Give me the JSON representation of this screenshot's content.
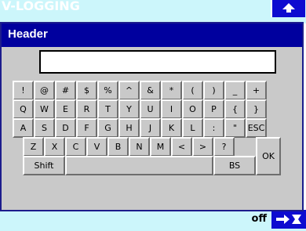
{
  "background": {
    "title": "V-LOGGING",
    "footer_text": "off"
  },
  "dialog": {
    "header": "Header",
    "input_value": ""
  },
  "keyboard": {
    "row1": [
      "!",
      "@",
      "#",
      "$",
      "%",
      "^",
      "&",
      "*",
      "(",
      ")",
      "_",
      "+"
    ],
    "row2": [
      "Q",
      "W",
      "E",
      "R",
      "T",
      "Y",
      "U",
      "I",
      "O",
      "P",
      "{",
      "}"
    ],
    "row3": [
      "A",
      "S",
      "D",
      "F",
      "G",
      "H",
      "J",
      "K",
      "L",
      ":",
      "\"",
      "ESC"
    ],
    "row4": [
      "Z",
      "X",
      "C",
      "V",
      "B",
      "N",
      "M",
      "<",
      ">",
      "?"
    ],
    "shift": "Shift",
    "space": "",
    "bs": "BS",
    "ok": "OK"
  },
  "colors": {
    "header_bg": "#00009e",
    "dialog_bg": "#c9c9c9",
    "background_bar": "#ccf6fb",
    "nav_button": "#0d0bd0"
  },
  "icons": {
    "up": "up-arrow-icon",
    "nav": "arrows-icon"
  }
}
